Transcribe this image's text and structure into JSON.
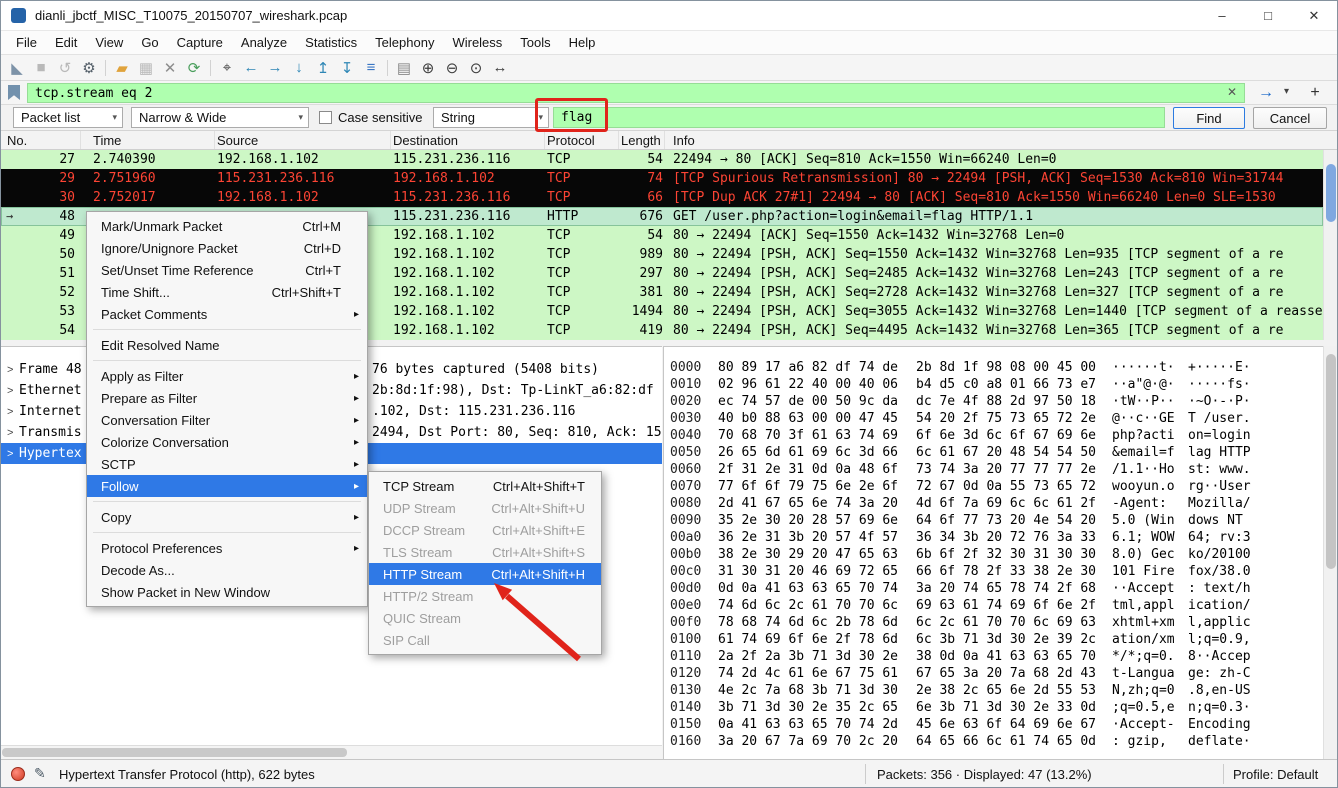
{
  "window": {
    "title": "dianli_jbctf_MISC_T10075_20150707_wireshark.pcap",
    "controls": {
      "minimize": "–",
      "maximize": "□",
      "close": "✕"
    }
  },
  "menu_bar": {
    "items": [
      {
        "label": "File"
      },
      {
        "label": "Edit"
      },
      {
        "label": "View"
      },
      {
        "label": "Go"
      },
      {
        "label": "Capture"
      },
      {
        "label": "Analyze"
      },
      {
        "label": "Statistics"
      },
      {
        "label": "Telephony"
      },
      {
        "label": "Wireless"
      },
      {
        "label": "Tools"
      },
      {
        "label": "Help"
      }
    ]
  },
  "toolbar": {
    "icons": [
      {
        "name": "start-capture-icon",
        "glyph": "◣",
        "color": "#7d93a8"
      },
      {
        "name": "stop-capture-icon",
        "glyph": "■",
        "color": "#b9b9b9"
      },
      {
        "name": "restart-capture-icon",
        "glyph": "↺",
        "color": "#b9b9b9"
      },
      {
        "name": "capture-options-icon",
        "glyph": "⚙",
        "color": "#55606a"
      },
      {
        "cls": "sep"
      },
      {
        "name": "open-file-icon",
        "glyph": "▰",
        "color": "#e0a33c"
      },
      {
        "name": "save-file-icon",
        "glyph": "▦",
        "color": "#b9b9b9"
      },
      {
        "name": "close-file-icon",
        "glyph": "✕",
        "color": "#8d8d8d"
      },
      {
        "name": "reload-icon",
        "glyph": "⟳",
        "color": "#4a9e5c"
      },
      {
        "cls": "sep"
      },
      {
        "name": "find-packet-icon",
        "glyph": "⌖",
        "color": "#3d3d3d"
      },
      {
        "name": "back-icon",
        "glyph": "←",
        "color": "#2e86b5"
      },
      {
        "name": "forward-icon",
        "glyph": "→",
        "color": "#2e86b5"
      },
      {
        "name": "goto-packet-icon",
        "glyph": "↓",
        "color": "#2e86b5"
      },
      {
        "name": "first-packet-icon",
        "glyph": "↥",
        "color": "#2e86b5"
      },
      {
        "name": "last-packet-icon",
        "glyph": "↧",
        "color": "#2e86b5"
      },
      {
        "name": "autoscroll-icon",
        "glyph": "≡",
        "color": "#3a76c4"
      },
      {
        "cls": "sep"
      },
      {
        "name": "colorize-icon",
        "glyph": "▤",
        "color": "#888888"
      },
      {
        "name": "zoom-in-icon",
        "glyph": "⊕",
        "color": "#3d3d3d"
      },
      {
        "name": "zoom-out-icon",
        "glyph": "⊖",
        "color": "#3d3d3d"
      },
      {
        "name": "zoom-reset-icon",
        "glyph": "⊙",
        "color": "#3d3d3d"
      },
      {
        "name": "resize-columns-icon",
        "glyph": "↔",
        "color": "#3d3d3d"
      }
    ]
  },
  "filter_bar": {
    "value": "tcp.stream eq 2",
    "clear_glyph": "✕",
    "apply_glyph": "→",
    "caret_glyph": "▾",
    "add_glyph": "+"
  },
  "find_bar": {
    "scope": "Packet list",
    "charset": "Narrow & Wide",
    "case_label": "Case sensitive",
    "type": "String",
    "query": "flag",
    "find_label": "Find",
    "cancel_label": "Cancel",
    "caret_glyph": "▾"
  },
  "packet_list": {
    "columns": [
      {
        "label": "No."
      },
      {
        "label": "Time"
      },
      {
        "label": "Source"
      },
      {
        "label": "Destination"
      },
      {
        "label": "Protocol"
      },
      {
        "label": "Length"
      },
      {
        "label": "Info"
      }
    ],
    "rows": [
      {
        "no": "27",
        "time": "2.740390",
        "src": "192.168.1.102",
        "dst": "115.231.236.116",
        "proto": "TCP",
        "len": "54",
        "info": "22494 → 80 [ACK] Seq=810 Ack=1550 Win=66240 Len=0",
        "style": "green"
      },
      {
        "no": "29",
        "time": "2.751960",
        "src": "115.231.236.116",
        "dst": "192.168.1.102",
        "proto": "TCP",
        "len": "74",
        "info": "[TCP Spurious Retransmission] 80 → 22494 [PSH, ACK] Seq=1530 Ack=810 Win=31744",
        "style": "bad"
      },
      {
        "no": "30",
        "time": "2.752017",
        "src": "192.168.1.102",
        "dst": "115.231.236.116",
        "proto": "TCP",
        "len": "66",
        "info": "[TCP Dup ACK 27#1] 22494 → 80 [ACK] Seq=810 Ack=1550 Win=66240 Len=0 SLE=1530",
        "style": "bad"
      },
      {
        "no": "48",
        "time": "",
        "src": "",
        "dst": "115.231.236.116",
        "proto": "HTTP",
        "len": "676",
        "info": "GET /user.php?action=login&email=flag HTTP/1.1",
        "style": "selected"
      },
      {
        "no": "49",
        "time": "",
        "src": "",
        "dst": "192.168.1.102",
        "proto": "TCP",
        "len": "54",
        "info": "80 → 22494 [ACK] Seq=1550 Ack=1432 Win=32768 Len=0",
        "style": "green"
      },
      {
        "no": "50",
        "time": "",
        "src": "",
        "dst": "192.168.1.102",
        "proto": "TCP",
        "len": "989",
        "info": "80 → 22494 [PSH, ACK] Seq=1550 Ack=1432 Win=32768 Len=935 [TCP segment of a re",
        "style": "green"
      },
      {
        "no": "51",
        "time": "",
        "src": "",
        "dst": "192.168.1.102",
        "proto": "TCP",
        "len": "297",
        "info": "80 → 22494 [PSH, ACK] Seq=2485 Ack=1432 Win=32768 Len=243 [TCP segment of a re",
        "style": "green"
      },
      {
        "no": "52",
        "time": "",
        "src": "",
        "dst": "192.168.1.102",
        "proto": "TCP",
        "len": "381",
        "info": "80 → 22494 [PSH, ACK] Seq=2728 Ack=1432 Win=32768 Len=327 [TCP segment of a re",
        "style": "green"
      },
      {
        "no": "53",
        "time": "",
        "src": "",
        "dst": "192.168.1.102",
        "proto": "TCP",
        "len": "1494",
        "info": "80 → 22494 [PSH, ACK] Seq=3055 Ack=1432 Win=32768 Len=1440 [TCP segment of a reasse",
        "style": "green"
      },
      {
        "no": "54",
        "time": "",
        "src": "",
        "dst": "192.168.1.102",
        "proto": "TCP",
        "len": "419",
        "info": "80 → 22494 [PSH, ACK] Seq=4495 Ack=1432 Win=32768 Len=365 [TCP segment of a re",
        "style": "green"
      }
    ]
  },
  "context_menu": {
    "items": [
      {
        "label": "Mark/Unmark Packet",
        "shortcut": "Ctrl+M",
        "arrow": "",
        "cls": ""
      },
      {
        "label": "Ignore/Unignore Packet",
        "shortcut": "Ctrl+D",
        "arrow": "",
        "cls": ""
      },
      {
        "label": "Set/Unset Time Reference",
        "shortcut": "Ctrl+T",
        "arrow": "",
        "cls": ""
      },
      {
        "label": "Time Shift...",
        "shortcut": "Ctrl+Shift+T",
        "arrow": "",
        "cls": ""
      },
      {
        "label": "Packet Comments",
        "shortcut": "",
        "arrow": "▸",
        "cls": ""
      },
      {
        "cls": "sep"
      },
      {
        "label": "Edit Resolved Name",
        "shortcut": "",
        "arrow": "",
        "cls": ""
      },
      {
        "cls": "sep"
      },
      {
        "label": "Apply as Filter",
        "shortcut": "",
        "arrow": "▸",
        "cls": ""
      },
      {
        "label": "Prepare as Filter",
        "shortcut": "",
        "arrow": "▸",
        "cls": ""
      },
      {
        "label": "Conversation Filter",
        "shortcut": "",
        "arrow": "▸",
        "cls": ""
      },
      {
        "label": "Colorize Conversation",
        "shortcut": "",
        "arrow": "▸",
        "cls": ""
      },
      {
        "label": "SCTP",
        "shortcut": "",
        "arrow": "▸",
        "cls": ""
      },
      {
        "label": "Follow",
        "shortcut": "",
        "arrow": "▸",
        "cls": "hl"
      },
      {
        "cls": "sep"
      },
      {
        "label": "Copy",
        "shortcut": "",
        "arrow": "▸",
        "cls": ""
      },
      {
        "cls": "sep"
      },
      {
        "label": "Protocol Preferences",
        "shortcut": "",
        "arrow": "▸",
        "cls": ""
      },
      {
        "label": "Decode As...",
        "shortcut": "",
        "arrow": "",
        "cls": ""
      },
      {
        "label": "Show Packet in New Window",
        "shortcut": "",
        "arrow": "",
        "cls": ""
      }
    ]
  },
  "follow_submenu": {
    "items": [
      {
        "label": "TCP Stream",
        "shortcut": "Ctrl+Alt+Shift+T",
        "cls": ""
      },
      {
        "label": "UDP Stream",
        "shortcut": "Ctrl+Alt+Shift+U",
        "cls": "disabled"
      },
      {
        "label": "DCCP Stream",
        "shortcut": "Ctrl+Alt+Shift+E",
        "cls": "disabled"
      },
      {
        "label": "TLS Stream",
        "shortcut": "Ctrl+Alt+Shift+S",
        "cls": "disabled"
      },
      {
        "label": "HTTP Stream",
        "shortcut": "Ctrl+Alt+Shift+H",
        "cls": "hl"
      },
      {
        "label": "HTTP/2 Stream",
        "shortcut": "",
        "cls": "disabled"
      },
      {
        "label": "QUIC Stream",
        "shortcut": "",
        "cls": "disabled"
      },
      {
        "label": "SIP Call",
        "shortcut": "",
        "cls": "disabled"
      }
    ]
  },
  "details": {
    "rows": [
      {
        "exp": ">",
        "left": "Frame 48",
        "right": "76 bytes captured (5408 bits)",
        "cls": ""
      },
      {
        "exp": ">",
        "left": "Ethernet",
        "right": "2b:8d:1f:98), Dst: Tp-LinkT_a6:82:df",
        "cls": ""
      },
      {
        "exp": ">",
        "left": "Internet",
        "right": ".102, Dst: 115.231.236.116",
        "cls": ""
      },
      {
        "exp": ">",
        "left": "Transmis",
        "right": "2494, Dst Port: 80, Seq: 810, Ack: 15",
        "cls": ""
      },
      {
        "exp": ">",
        "left": "Hypertex",
        "right": "",
        "cls": "selected"
      }
    ]
  },
  "hex_view": {
    "rows": [
      {
        "off": "0000",
        "h1": "80 89 17 a6 82 df 74 de",
        "h2": "2b 8d 1f 98 08 00 45 00",
        "a1": "······t·",
        "a2": "+·····E·"
      },
      {
        "off": "0010",
        "h1": "02 96 61 22 40 00 40 06",
        "h2": "b4 d5 c0 a8 01 66 73 e7",
        "a1": "··a\"@·@·",
        "a2": "·····fs·"
      },
      {
        "off": "0020",
        "h1": "ec 74 57 de 00 50 9c da",
        "h2": "dc 7e 4f 88 2d 97 50 18",
        "a1": "·tW··P··",
        "a2": "·~O·-·P·"
      },
      {
        "off": "0030",
        "h1": "40 b0 88 63 00 00 47 45",
        "h2": "54 20 2f 75 73 65 72 2e",
        "a1": "@··c··GE",
        "a2": "T /user."
      },
      {
        "off": "0040",
        "h1": "70 68 70 3f 61 63 74 69",
        "h2": "6f 6e 3d 6c 6f 67 69 6e",
        "a1": "php?acti",
        "a2": "on=login"
      },
      {
        "off": "0050",
        "h1": "26 65 6d 61 69 6c 3d 66",
        "h2": "6c 61 67 20 48 54 54 50",
        "a1": "&email=f",
        "a2": "lag HTTP"
      },
      {
        "off": "0060",
        "h1": "2f 31 2e 31 0d 0a 48 6f",
        "h2": "73 74 3a 20 77 77 77 2e",
        "a1": "/1.1··Ho",
        "a2": "st: www."
      },
      {
        "off": "0070",
        "h1": "77 6f 6f 79 75 6e 2e 6f",
        "h2": "72 67 0d 0a 55 73 65 72",
        "a1": "wooyun.o",
        "a2": "rg··User"
      },
      {
        "off": "0080",
        "h1": "2d 41 67 65 6e 74 3a 20",
        "h2": "4d 6f 7a 69 6c 6c 61 2f",
        "a1": "-Agent: ",
        "a2": "Mozilla/"
      },
      {
        "off": "0090",
        "h1": "35 2e 30 20 28 57 69 6e",
        "h2": "64 6f 77 73 20 4e 54 20",
        "a1": "5.0 (Win",
        "a2": "dows NT "
      },
      {
        "off": "00a0",
        "h1": "36 2e 31 3b 20 57 4f 57",
        "h2": "36 34 3b 20 72 76 3a 33",
        "a1": "6.1; WOW",
        "a2": "64; rv:3"
      },
      {
        "off": "00b0",
        "h1": "38 2e 30 29 20 47 65 63",
        "h2": "6b 6f 2f 32 30 31 30 30",
        "a1": "8.0) Gec",
        "a2": "ko/20100"
      },
      {
        "off": "00c0",
        "h1": "31 30 31 20 46 69 72 65",
        "h2": "66 6f 78 2f 33 38 2e 30",
        "a1": "101 Fire",
        "a2": "fox/38.0"
      },
      {
        "off": "00d0",
        "h1": "0d 0a 41 63 63 65 70 74",
        "h2": "3a 20 74 65 78 74 2f 68",
        "a1": "··Accept",
        "a2": ": text/h"
      },
      {
        "off": "00e0",
        "h1": "74 6d 6c 2c 61 70 70 6c",
        "h2": "69 63 61 74 69 6f 6e 2f",
        "a1": "tml,appl",
        "a2": "ication/"
      },
      {
        "off": "00f0",
        "h1": "78 68 74 6d 6c 2b 78 6d",
        "h2": "6c 2c 61 70 70 6c 69 63",
        "a1": "xhtml+xm",
        "a2": "l,applic"
      },
      {
        "off": "0100",
        "h1": "61 74 69 6f 6e 2f 78 6d",
        "h2": "6c 3b 71 3d 30 2e 39 2c",
        "a1": "ation/xm",
        "a2": "l;q=0.9,"
      },
      {
        "off": "0110",
        "h1": "2a 2f 2a 3b 71 3d 30 2e",
        "h2": "38 0d 0a 41 63 63 65 70",
        "a1": "*/*;q=0.",
        "a2": "8··Accep"
      },
      {
        "off": "0120",
        "h1": "74 2d 4c 61 6e 67 75 61",
        "h2": "67 65 3a 20 7a 68 2d 43",
        "a1": "t-Langua",
        "a2": "ge: zh-C"
      },
      {
        "off": "0130",
        "h1": "4e 2c 7a 68 3b 71 3d 30",
        "h2": "2e 38 2c 65 6e 2d 55 53",
        "a1": "N,zh;q=0",
        "a2": ".8,en-US"
      },
      {
        "off": "0140",
        "h1": "3b 71 3d 30 2e 35 2c 65",
        "h2": "6e 3b 71 3d 30 2e 33 0d",
        "a1": ";q=0.5,e",
        "a2": "n;q=0.3·"
      },
      {
        "off": "0150",
        "h1": "0a 41 63 63 65 70 74 2d",
        "h2": "45 6e 63 6f 64 69 6e 67",
        "a1": "·Accept-",
        "a2": "Encoding"
      },
      {
        "off": "0160",
        "h1": "3a 20 67 7a 69 70 2c 20",
        "h2": "64 65 66 6c 61 74 65 0d",
        "a1": ": gzip, ",
        "a2": "deflate·"
      }
    ]
  },
  "status_bar": {
    "left": "Hypertext Transfer Protocol (http), 622 bytes",
    "middle": "Packets: 356 · Displayed: 47 (13.2%)",
    "right": "Profile: Default",
    "pencil_glyph": "✎"
  }
}
